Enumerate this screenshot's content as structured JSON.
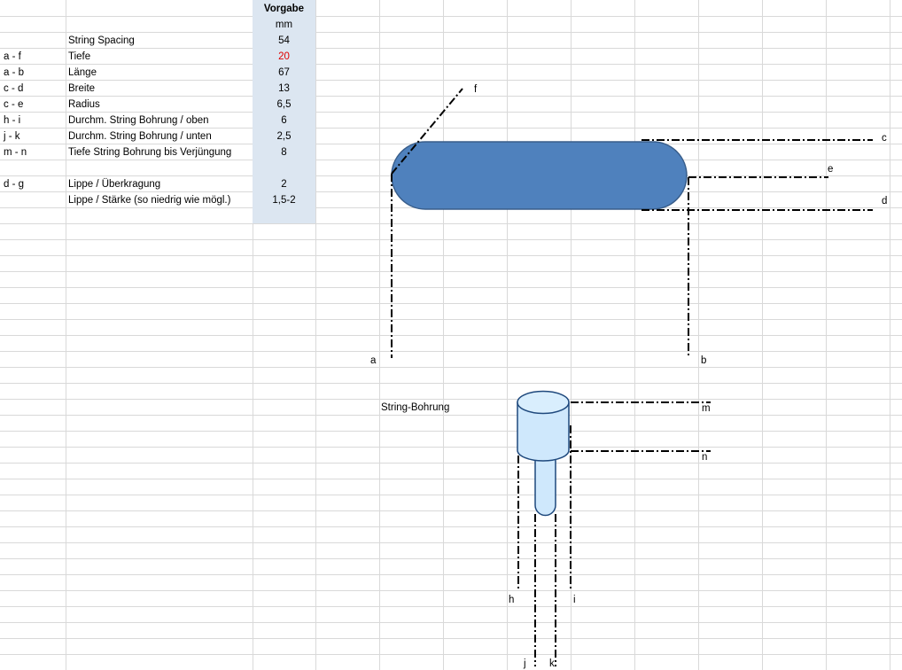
{
  "header": {
    "vorgabe": "Vorgabe",
    "unit": "mm"
  },
  "rows": [
    {
      "code": "",
      "label": "String Spacing",
      "value": "54",
      "highlight": false
    },
    {
      "code": "a - f",
      "label": "Tiefe",
      "value": "20",
      "highlight": true
    },
    {
      "code": "a - b",
      "label": "Länge",
      "value": "67",
      "highlight": false
    },
    {
      "code": "c - d",
      "label": "Breite",
      "value": "13",
      "highlight": false
    },
    {
      "code": "c - e",
      "label": "Radius",
      "value": "6,5",
      "highlight": false
    },
    {
      "code": "h - i",
      "label": "Durchm. String Bohrung / oben",
      "value": "6",
      "highlight": false
    },
    {
      "code": "j - k",
      "label": "Durchm. String Bohrung / unten",
      "value": "2,5",
      "highlight": false
    },
    {
      "code": "m - n",
      "label": "Tiefe String Bohrung bis Verjüngung",
      "value": "8",
      "highlight": false
    },
    {
      "code": "",
      "label": "",
      "value": "",
      "highlight": false
    },
    {
      "code": "d - g",
      "label": "Lippe / Überkragung",
      "value": "2",
      "highlight": false
    },
    {
      "code": "",
      "label": "Lippe / Stärke (so niedrig wie mögl.)",
      "value": "1,5-2",
      "highlight": false
    }
  ],
  "drawing": {
    "points": {
      "a": "a",
      "b": "b",
      "c": "c",
      "d": "d",
      "e": "e",
      "f": "f",
      "h": "h",
      "i": "i",
      "j": "j",
      "k": "k",
      "m": "m",
      "n": "n"
    },
    "bore_title": "String-Bohrung"
  },
  "colors": {
    "saddle_fill": "#4f81bd",
    "saddle_stroke": "#385d8a",
    "bore_fill": "#cfe8fc",
    "bore_stroke": "#1f497d",
    "shade": "#dce6f1",
    "highlight": "#e00000"
  }
}
